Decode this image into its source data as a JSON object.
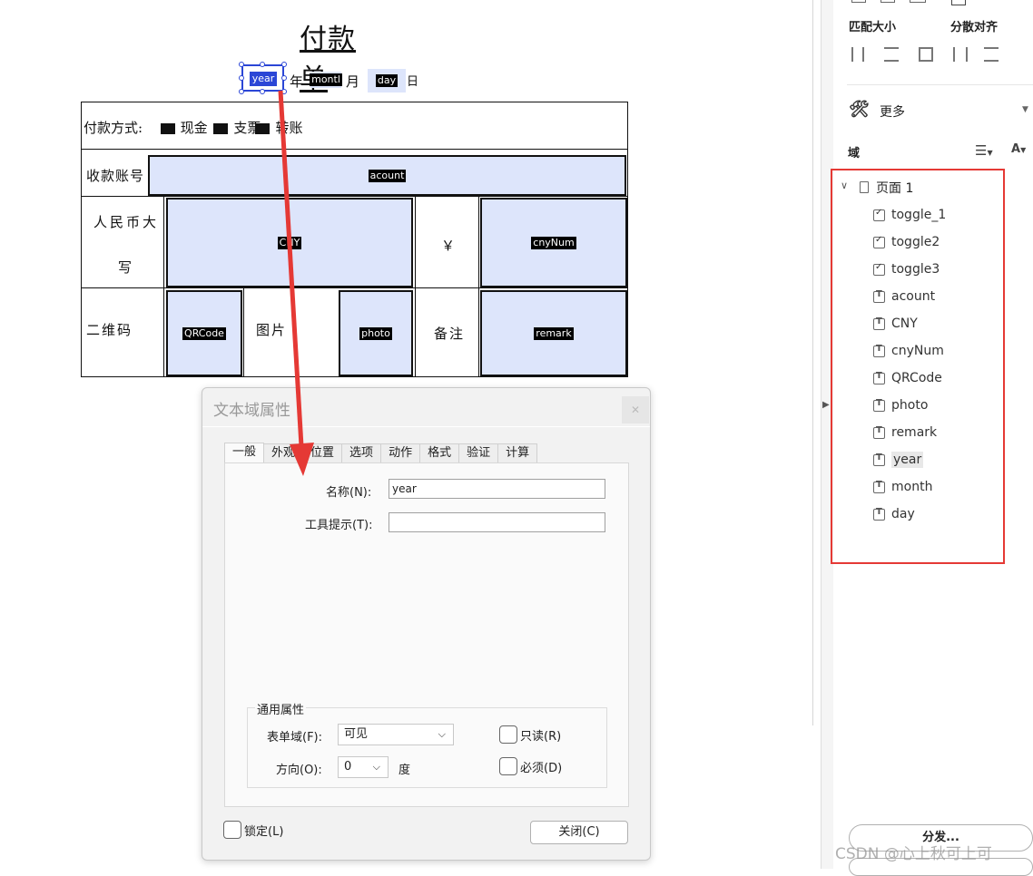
{
  "doc": {
    "title": "付款单",
    "date_fields": {
      "year": "year",
      "year_unit": "年",
      "month": "montl",
      "month_unit": "月",
      "day": "day",
      "day_unit": "日"
    },
    "payment": {
      "label": "付款方式:",
      "opt1": "现金",
      "opt2": "支票",
      "opt3": "转账"
    },
    "account_label": "收款账号",
    "account_field": "acount",
    "rmb_label_1": "人民币大",
    "rmb_label_2": "写",
    "cny_field": "CNY",
    "yen_symbol": "￥",
    "cnynum_field": "cnyNum",
    "qr_label": "二维码",
    "qr_field": "QRCode",
    "image_label": "图片",
    "photo_field": "photo",
    "remark_label": "备注",
    "remark_field": "remark"
  },
  "dialog": {
    "title": "文本域属性",
    "close_icon": "✕",
    "tabs": [
      "一般",
      "外观",
      "位置",
      "选项",
      "动作",
      "格式",
      "验证",
      "计算"
    ],
    "name_label": "名称(N):",
    "name_value": "year",
    "tooltip_label": "工具提示(T):",
    "tooltip_value": "",
    "group_title": "通用属性",
    "form_field_label": "表单域(F):",
    "form_field_value": "可见",
    "readonly_label": "只读(R)",
    "direction_label": "方向(O):",
    "direction_value": "0",
    "degree_label": "度",
    "required_label": "必须(D)",
    "lock_label": "锁定(L)",
    "close_button": "关闭(C)"
  },
  "right_panel": {
    "match_size": "匹配大小",
    "distribute_align": "分散对齐",
    "more": "更多",
    "fields_label": "域",
    "page_node": "页面 1",
    "items": [
      {
        "name": "toggle_1",
        "kind": "checkbox"
      },
      {
        "name": "toggle2",
        "kind": "checkbox"
      },
      {
        "name": "toggle3",
        "kind": "checkbox"
      },
      {
        "name": "acount",
        "kind": "text"
      },
      {
        "name": "CNY",
        "kind": "text"
      },
      {
        "name": "cnyNum",
        "kind": "text"
      },
      {
        "name": "QRCode",
        "kind": "text"
      },
      {
        "name": "photo",
        "kind": "text"
      },
      {
        "name": "remark",
        "kind": "text"
      },
      {
        "name": "year",
        "kind": "text",
        "selected": true
      },
      {
        "name": "month",
        "kind": "text"
      },
      {
        "name": "day",
        "kind": "text"
      }
    ],
    "distribute_button": "分发...",
    "watermark": "CSDN @心上秋可上可"
  },
  "colors": {
    "field_fill": "#dde5fb",
    "highlight_red": "#e53935",
    "selection_blue": "#2b46d6"
  }
}
